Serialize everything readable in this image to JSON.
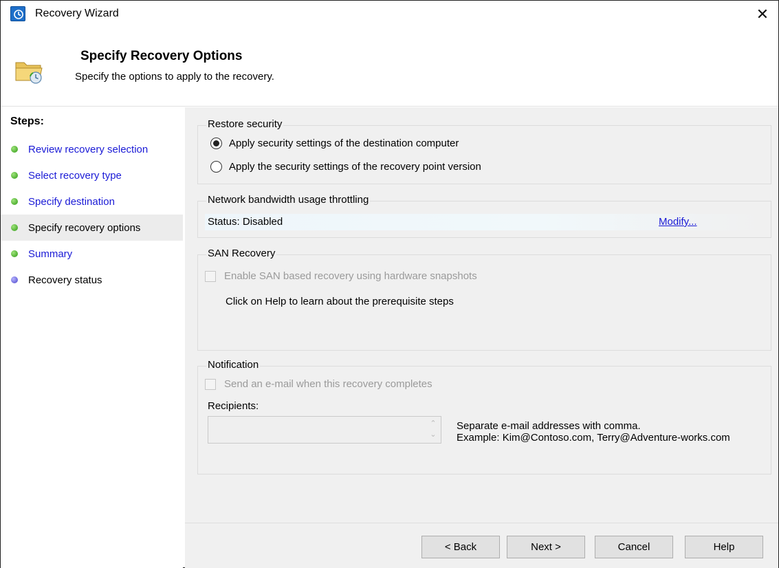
{
  "window": {
    "title": "Recovery Wizard",
    "close_glyph": "✕"
  },
  "header": {
    "title": "Specify Recovery Options",
    "subtitle": "Specify the options to apply to the recovery.",
    "icon": "folder-recovery-icon"
  },
  "steps": {
    "label": "Steps:",
    "items": [
      {
        "label": "Review recovery selection",
        "state": "completed",
        "link": true
      },
      {
        "label": "Select recovery type",
        "state": "completed",
        "link": true
      },
      {
        "label": "Specify destination",
        "state": "completed",
        "link": true
      },
      {
        "label": "Specify recovery options",
        "state": "current",
        "link": false
      },
      {
        "label": "Summary",
        "state": "completed",
        "link": true
      },
      {
        "label": "Recovery status",
        "state": "pending",
        "link": false
      }
    ]
  },
  "restore_security": {
    "title": "Restore security",
    "options": [
      {
        "label": "Apply security settings of the destination computer",
        "checked": true
      },
      {
        "label": "Apply the security settings of the recovery point version",
        "checked": false
      }
    ]
  },
  "throttling": {
    "title": "Network bandwidth usage throttling",
    "status": "Status: Disabled",
    "modify_label": "Modify..."
  },
  "san": {
    "title": "SAN Recovery",
    "checkbox_label": "Enable SAN based recovery using hardware snapshots",
    "help_text": "Click on Help to learn about the prerequisite steps"
  },
  "notification": {
    "title": "Notification",
    "checkbox_label": "Send an e-mail when this recovery completes",
    "recipients_label": "Recipients:",
    "recipients_value": "",
    "hint_line1": "Separate e-mail addresses with comma.",
    "hint_line2": "Example: Kim@Contoso.com, Terry@Adventure-works.com"
  },
  "buttons": {
    "back": "< Back",
    "next": "Next >",
    "cancel": "Cancel",
    "help": "Help"
  },
  "colors": {
    "link": "#1a1ad6",
    "panel": "#f0f0f0",
    "step_completed": "#2e9a12",
    "step_pending": "#4a45c9"
  }
}
